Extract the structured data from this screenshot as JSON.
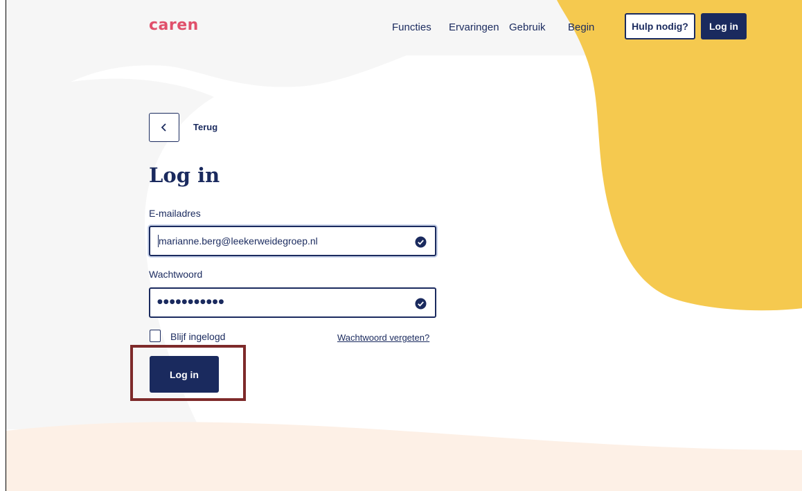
{
  "header": {
    "logo": "caren",
    "nav": [
      "Functies",
      "Ervaringen",
      "Gebruik",
      "Begin"
    ],
    "help_label": "Hulp nodig?",
    "login_label": "Log in"
  },
  "back": {
    "label": "Terug"
  },
  "form": {
    "title": "Log in",
    "email_label": "E-mailadres",
    "email_value": "marianne.berg@leekerweidegroep.nl",
    "password_label": "Wachtwoord",
    "password_mask": "●●●●●●●●●●●",
    "remember_label": "Blijf ingelogd",
    "forgot_label": "Wachtwoord vergeten?",
    "submit_label": "Log in"
  },
  "colors": {
    "navy": "#1a2a5e",
    "brand_pink": "#e0506b",
    "yellow": "#f5c94f",
    "peach": "#fdf0e6",
    "highlight": "#7e2a2a"
  }
}
